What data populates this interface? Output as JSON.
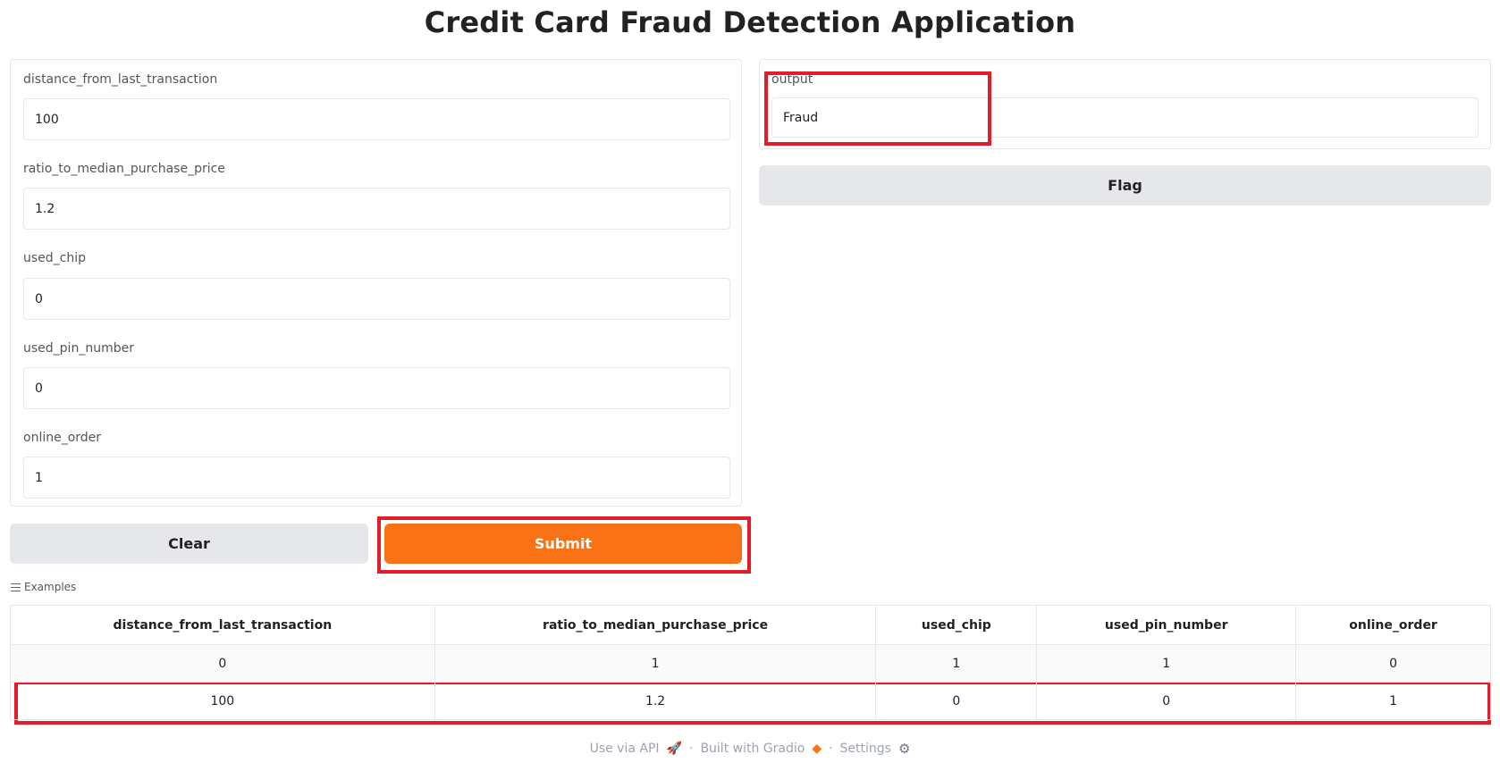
{
  "app": {
    "title": "Credit Card Fraud Detection Application"
  },
  "inputs": [
    {
      "label": "distance_from_last_transaction",
      "value": "100"
    },
    {
      "label": "ratio_to_median_purchase_price",
      "value": "1.2"
    },
    {
      "label": "used_chip",
      "value": "0"
    },
    {
      "label": "used_pin_number",
      "value": "0"
    },
    {
      "label": "online_order",
      "value": "1"
    }
  ],
  "output": {
    "label": "output",
    "value": "Fraud"
  },
  "buttons": {
    "flag": "Flag",
    "clear": "Clear",
    "submit": "Submit"
  },
  "examples": {
    "label": "Examples",
    "headers": [
      "distance_from_last_transaction",
      "ratio_to_median_purchase_price",
      "used_chip",
      "used_pin_number",
      "online_order"
    ],
    "rows": [
      [
        "0",
        "1",
        "1",
        "1",
        "0"
      ],
      [
        "100",
        "1.2",
        "0",
        "0",
        "1"
      ]
    ]
  },
  "footer": {
    "api": "Use via API",
    "built": "Built with Gradio",
    "settings": "Settings",
    "separator": "·"
  },
  "colors": {
    "primary": "#f97316",
    "highlight": "#e11d2a",
    "secondary_button": "#e5e7eb"
  },
  "icons": {
    "examples": "list-icon",
    "api": "rocket-icon",
    "built": "gradio-logo-icon",
    "settings": "gear-icon"
  }
}
